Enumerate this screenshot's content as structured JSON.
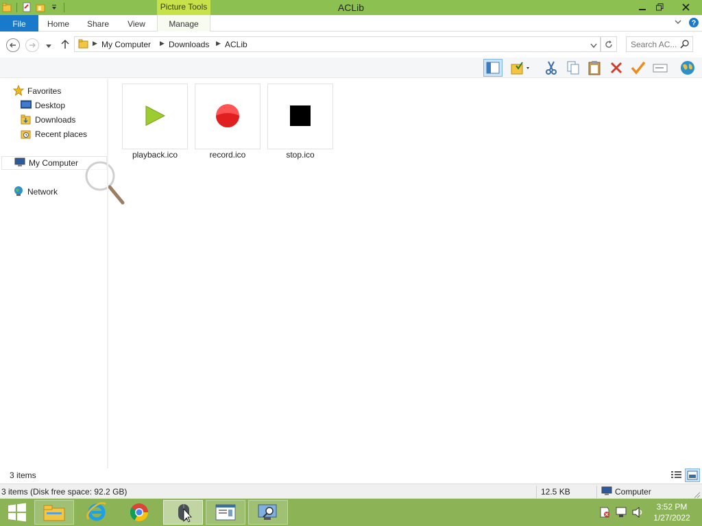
{
  "window": {
    "title": "ACLib",
    "context_tab": "Picture Tools"
  },
  "ribbon": {
    "tabs": [
      "File",
      "Home",
      "Share",
      "View",
      "Manage"
    ]
  },
  "address": {
    "crumbs": [
      "My Computer",
      "Downloads",
      "ACLib"
    ],
    "search_placeholder": "Search AC..."
  },
  "toolbar": {
    "icons": [
      "layout-icon",
      "folder-check-icon",
      "cut-icon",
      "copy-icon",
      "paste-icon",
      "delete-icon",
      "checkmark-icon",
      "rename-icon",
      "globe-icon"
    ]
  },
  "nav": {
    "favorites": "Favorites",
    "desktop": "Desktop",
    "downloads": "Downloads",
    "recent": "Recent places",
    "computer": "My Computer",
    "network": "Network"
  },
  "files": [
    {
      "name": "playback.ico",
      "icon": "play-icon"
    },
    {
      "name": "record.ico",
      "icon": "record-icon"
    },
    {
      "name": "stop.ico",
      "icon": "stop-icon"
    }
  ],
  "status": {
    "items": "3 items"
  },
  "details": {
    "summary": "3 items (Disk free space: 92.2 GB)",
    "size": "12.5 KB",
    "location": "Computer"
  },
  "clock": {
    "time": "3:52 PM",
    "date": "1/27/2022"
  },
  "colors": {
    "titlebar": "#8cc152",
    "context_tab": "#c7e14a",
    "file_tab": "#1979ca",
    "taskbar": "#8cb356"
  }
}
